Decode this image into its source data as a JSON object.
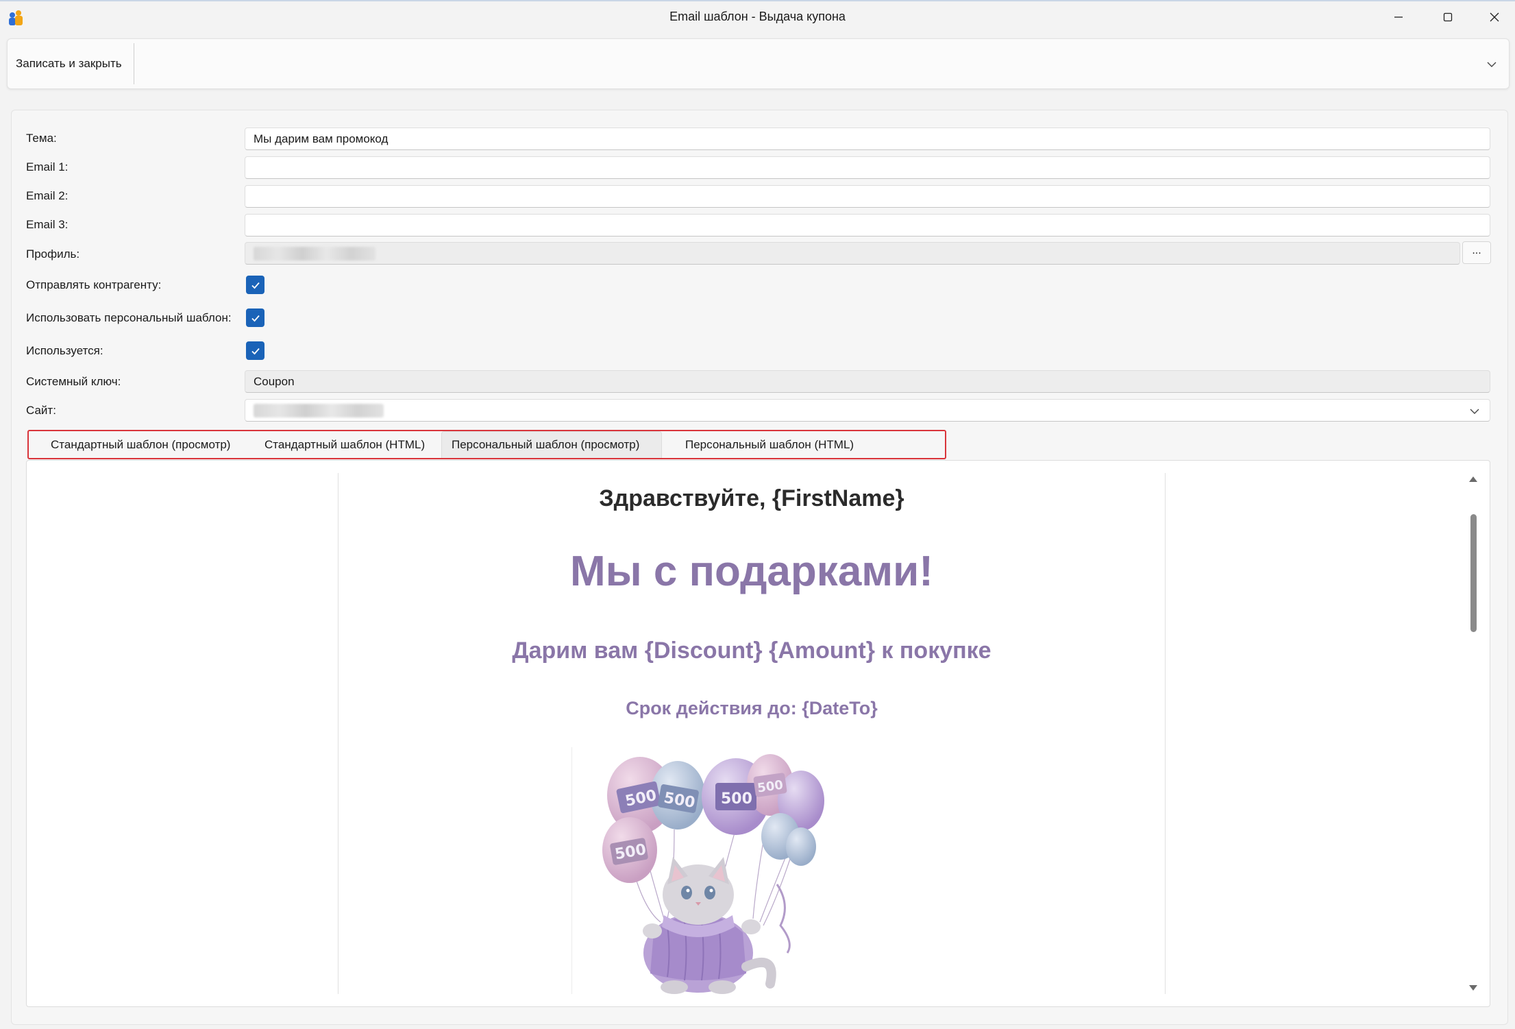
{
  "window": {
    "title": "Email шаблон - Выдача купона"
  },
  "toolbar": {
    "save_close_label": "Записать и закрыть"
  },
  "form": {
    "subject": {
      "label": "Тема:",
      "value": "Мы дарим вам промокод"
    },
    "email1": {
      "label": "Email 1:",
      "value": ""
    },
    "email2": {
      "label": "Email 2:",
      "value": ""
    },
    "email3": {
      "label": "Email 3:",
      "value": ""
    },
    "profile": {
      "label": "Профиль:",
      "button_label": "..."
    },
    "send_to_counterparty": {
      "label": "Отправлять контрагенту:",
      "checked": true
    },
    "use_personal_template": {
      "label": "Использовать персональный шаблон:",
      "checked": true
    },
    "in_use": {
      "label": "Используется:",
      "checked": true
    },
    "system_key": {
      "label": "Системный ключ:",
      "value": "Coupon"
    },
    "site": {
      "label": "Сайт:"
    }
  },
  "tabs": [
    {
      "label": "Стандартный шаблон (просмотр)",
      "active": false
    },
    {
      "label": "Стандартный шаблон (HTML)",
      "active": false
    },
    {
      "label": "Персональный шаблон (просмотр)",
      "active": true
    },
    {
      "label": "Персональный шаблон (HTML)",
      "active": false
    }
  ],
  "preview": {
    "greeting": "Здравствуйте, {FirstName}",
    "headline": "Мы с подарками!",
    "offer": "Дарим вам {Discount} {Amount} к покупке",
    "validity": "Срок действия до: {DateTo}",
    "balloon_value": "500"
  },
  "colors": {
    "accent_purple": "#8a76a8",
    "checkbox_blue": "#1a63b8",
    "highlight_red": "#d9343a"
  }
}
